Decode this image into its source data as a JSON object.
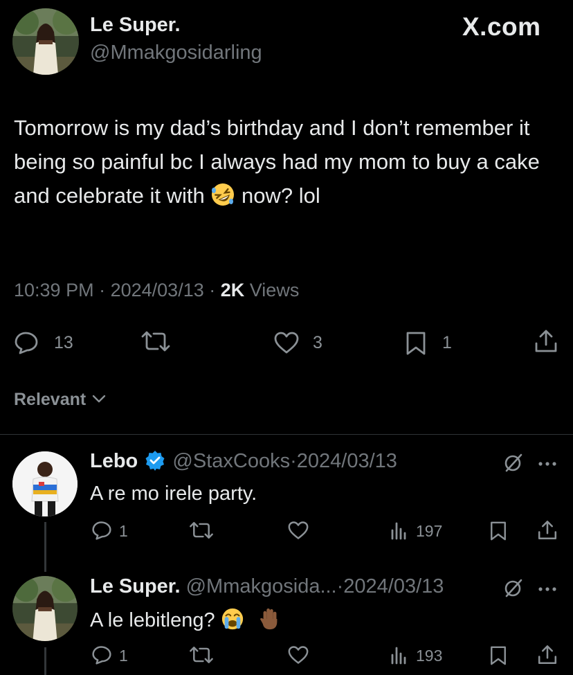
{
  "main_tweet": {
    "author_name": "Le Super.",
    "author_handle": "@Mmakgosidarling",
    "brand": "X.com",
    "text_before_emoji": "Tomorrow is my dad’s birthday and I don’t remember it being so painful bc I always had my mom to buy a cake and celebrate it with",
    "emoji": "rolling-on-floor-laughing",
    "text_after_emoji": " now? lol",
    "time": "10:39 PM",
    "date": "2024/03/13",
    "views_count": "2K",
    "views_label": "Views",
    "replies": "13",
    "likes": "3",
    "bookmarks": "1"
  },
  "filter_label": "Relevant",
  "replies": [
    {
      "name": "Lebo",
      "verified": true,
      "handle": "@StaxCooks",
      "date": "2024/03/13",
      "text": "A re mo irele party.",
      "replies": "1",
      "views": "197"
    },
    {
      "name": "Le Super.",
      "verified": false,
      "handle": "@Mmakgosida...",
      "date": "2024/03/13",
      "text": "A le lebitleng?",
      "emojis": [
        "loudly-crying-face",
        "raised-hand"
      ],
      "replies": "1",
      "views": "193"
    }
  ],
  "separator": "·",
  "colors": {
    "background": "#000000",
    "text": "#e7e9ea",
    "muted": "#71767b",
    "verified": "#1d9bf0"
  }
}
